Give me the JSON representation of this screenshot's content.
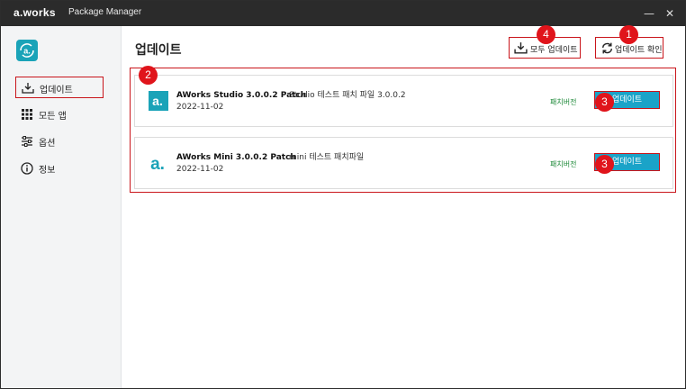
{
  "titlebar": {
    "brand": "a.works",
    "title": "Package Manager",
    "minimize": "—",
    "close": "✕"
  },
  "sidebar": {
    "items": [
      {
        "label": "업데이트",
        "icon": "download-icon",
        "active": true
      },
      {
        "label": "모든 앱",
        "icon": "grid-icon",
        "active": false
      },
      {
        "label": "옵션",
        "icon": "sliders-icon",
        "active": false
      },
      {
        "label": "정보",
        "icon": "info-icon",
        "active": false
      }
    ]
  },
  "main": {
    "title": "업데이트",
    "update_all_label": "모두 업데이트",
    "check_update_label": "업데이트 확인",
    "packages": [
      {
        "name": "AWorks Studio 3.0.0.2 Patch",
        "date": "2022-11-02",
        "description": "Studio 테스트 패치 파일 3.0.0.2",
        "tag": "패치버전",
        "button": "업데이트",
        "icon": "aworks-studio-icon"
      },
      {
        "name": "AWorks Mini 3.0.0.2 Patch",
        "date": "2022-11-02",
        "description": "mini 테스트 패치파일",
        "tag": "패치버전",
        "button": "업데이트",
        "icon": "aworks-mini-icon"
      }
    ]
  },
  "markers": {
    "m1": "1",
    "m2": "2",
    "m3a": "3",
    "m3b": "3",
    "m4": "4"
  },
  "colors": {
    "accent": "#1aa3c8",
    "highlight": "#c9151b",
    "marker": "#e0141b",
    "tag": "#1f8a3a",
    "titlebar": "#2b2b2b"
  }
}
